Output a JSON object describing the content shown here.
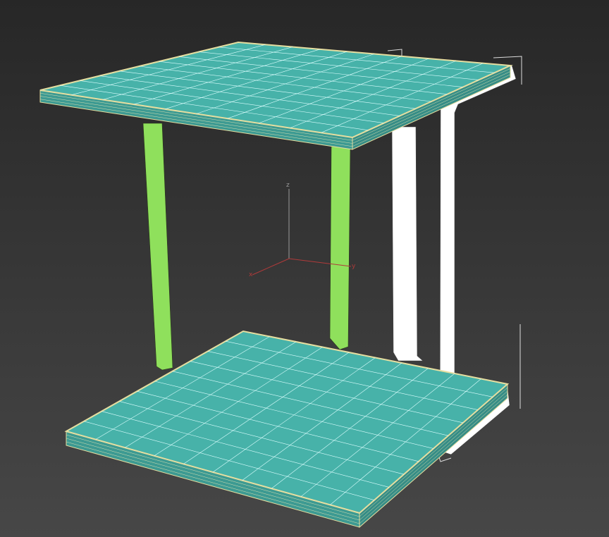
{
  "viewport": {
    "gizmo": {
      "z_label": "z",
      "x_label": "x",
      "y_label": "y"
    },
    "colors": {
      "slab": "#47b2a9",
      "slab_edge": "#e6dea0",
      "legs": "#8fe05c",
      "frame": "#ffffff",
      "x_axis": "#b03a3a",
      "z_axis": "#9a9a9a"
    },
    "grid_divisions": 10
  }
}
